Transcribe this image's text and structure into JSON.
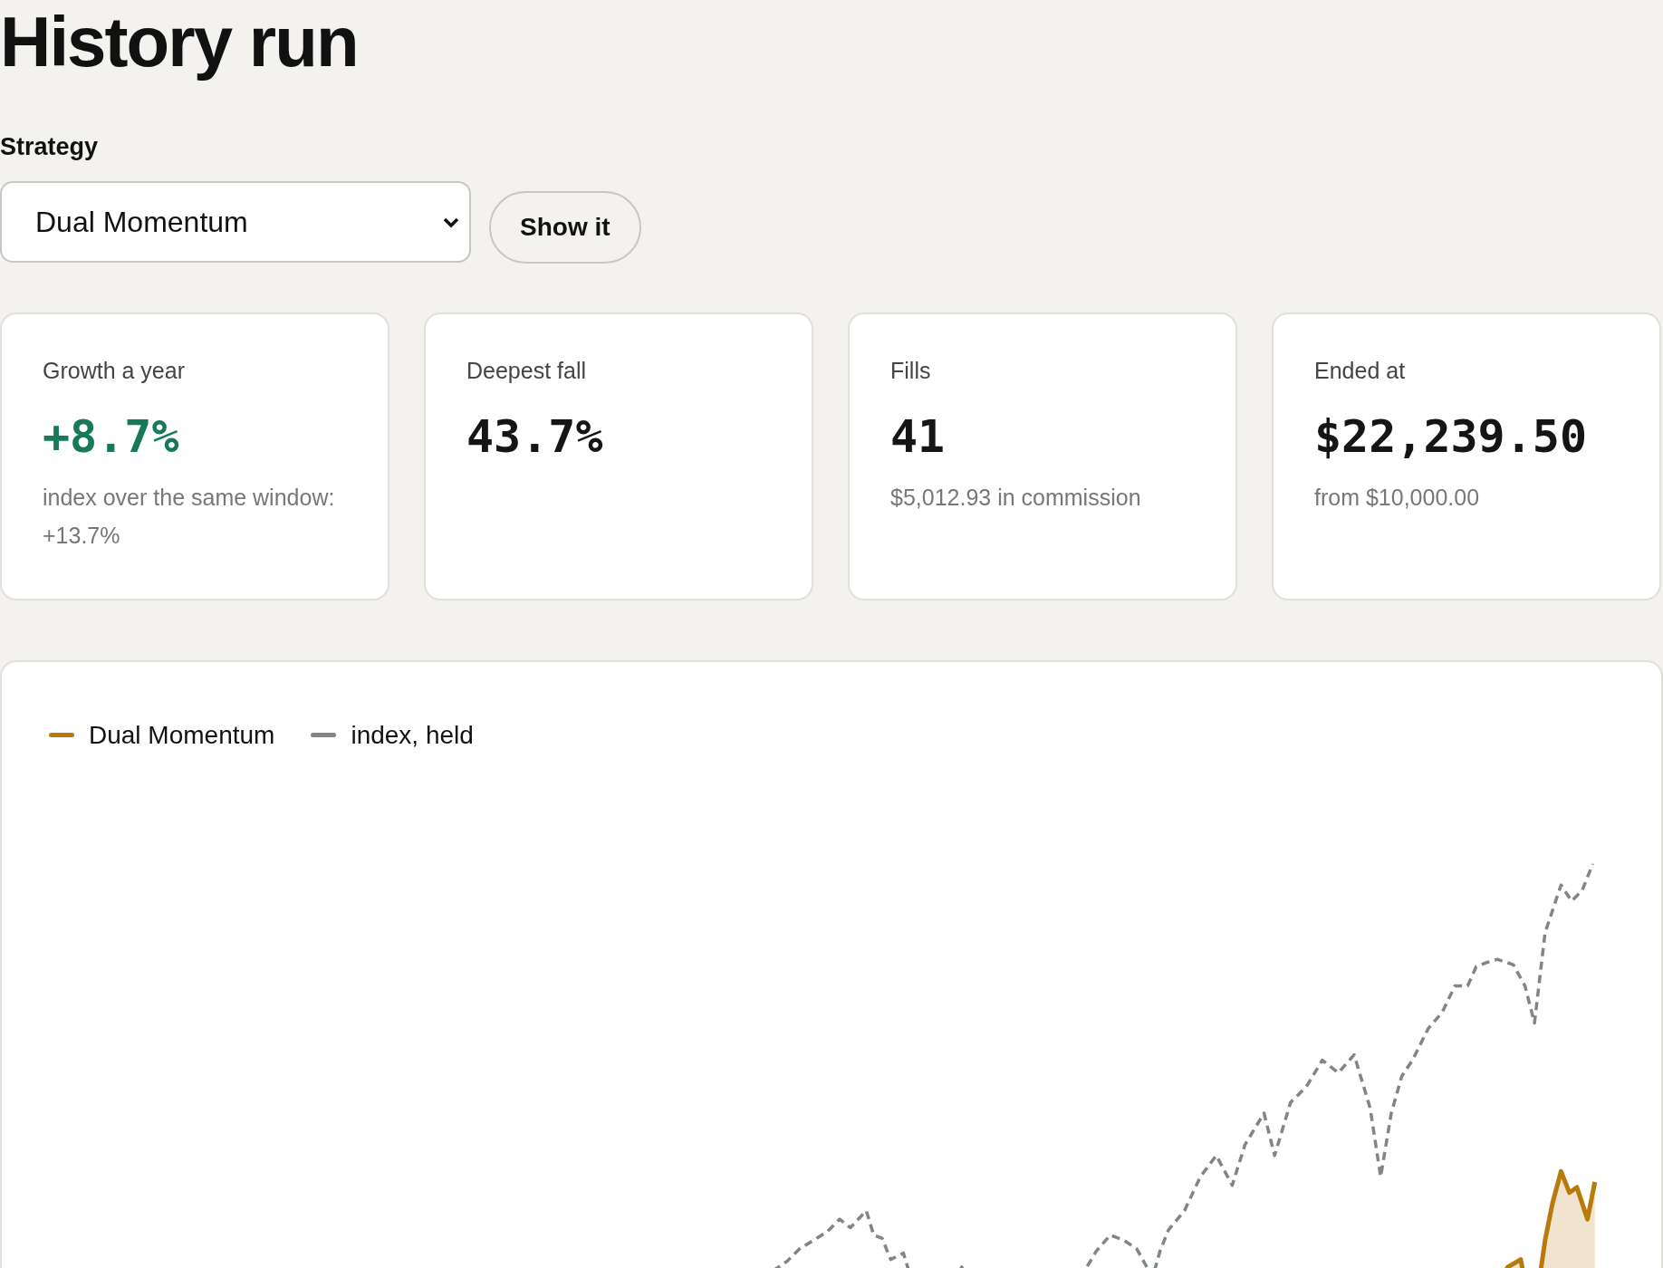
{
  "title": "History run",
  "strategy": {
    "label": "Strategy",
    "value": "Dual Momentum",
    "button": "Show it"
  },
  "cards": [
    {
      "label": "Growth a year",
      "value": "+8.7%",
      "color": "#17785a",
      "note": "index over the same window: +13.7%"
    },
    {
      "label": "Deepest fall",
      "value": "43.7%",
      "color": "#151515"
    },
    {
      "label": "Fills",
      "value": "41",
      "color": "#151515",
      "note": "$5,012.93 in commission"
    },
    {
      "label": "Ended at",
      "value": "$22,239.50",
      "color": "#151515",
      "note": "from $10,000.00"
    }
  ],
  "legend": [
    {
      "label": "Dual Momentum",
      "color": "#b87a0a",
      "kind": "solid"
    },
    {
      "label": "index, held",
      "color": "#7f8684",
      "kind": "dashed"
    }
  ]
}
